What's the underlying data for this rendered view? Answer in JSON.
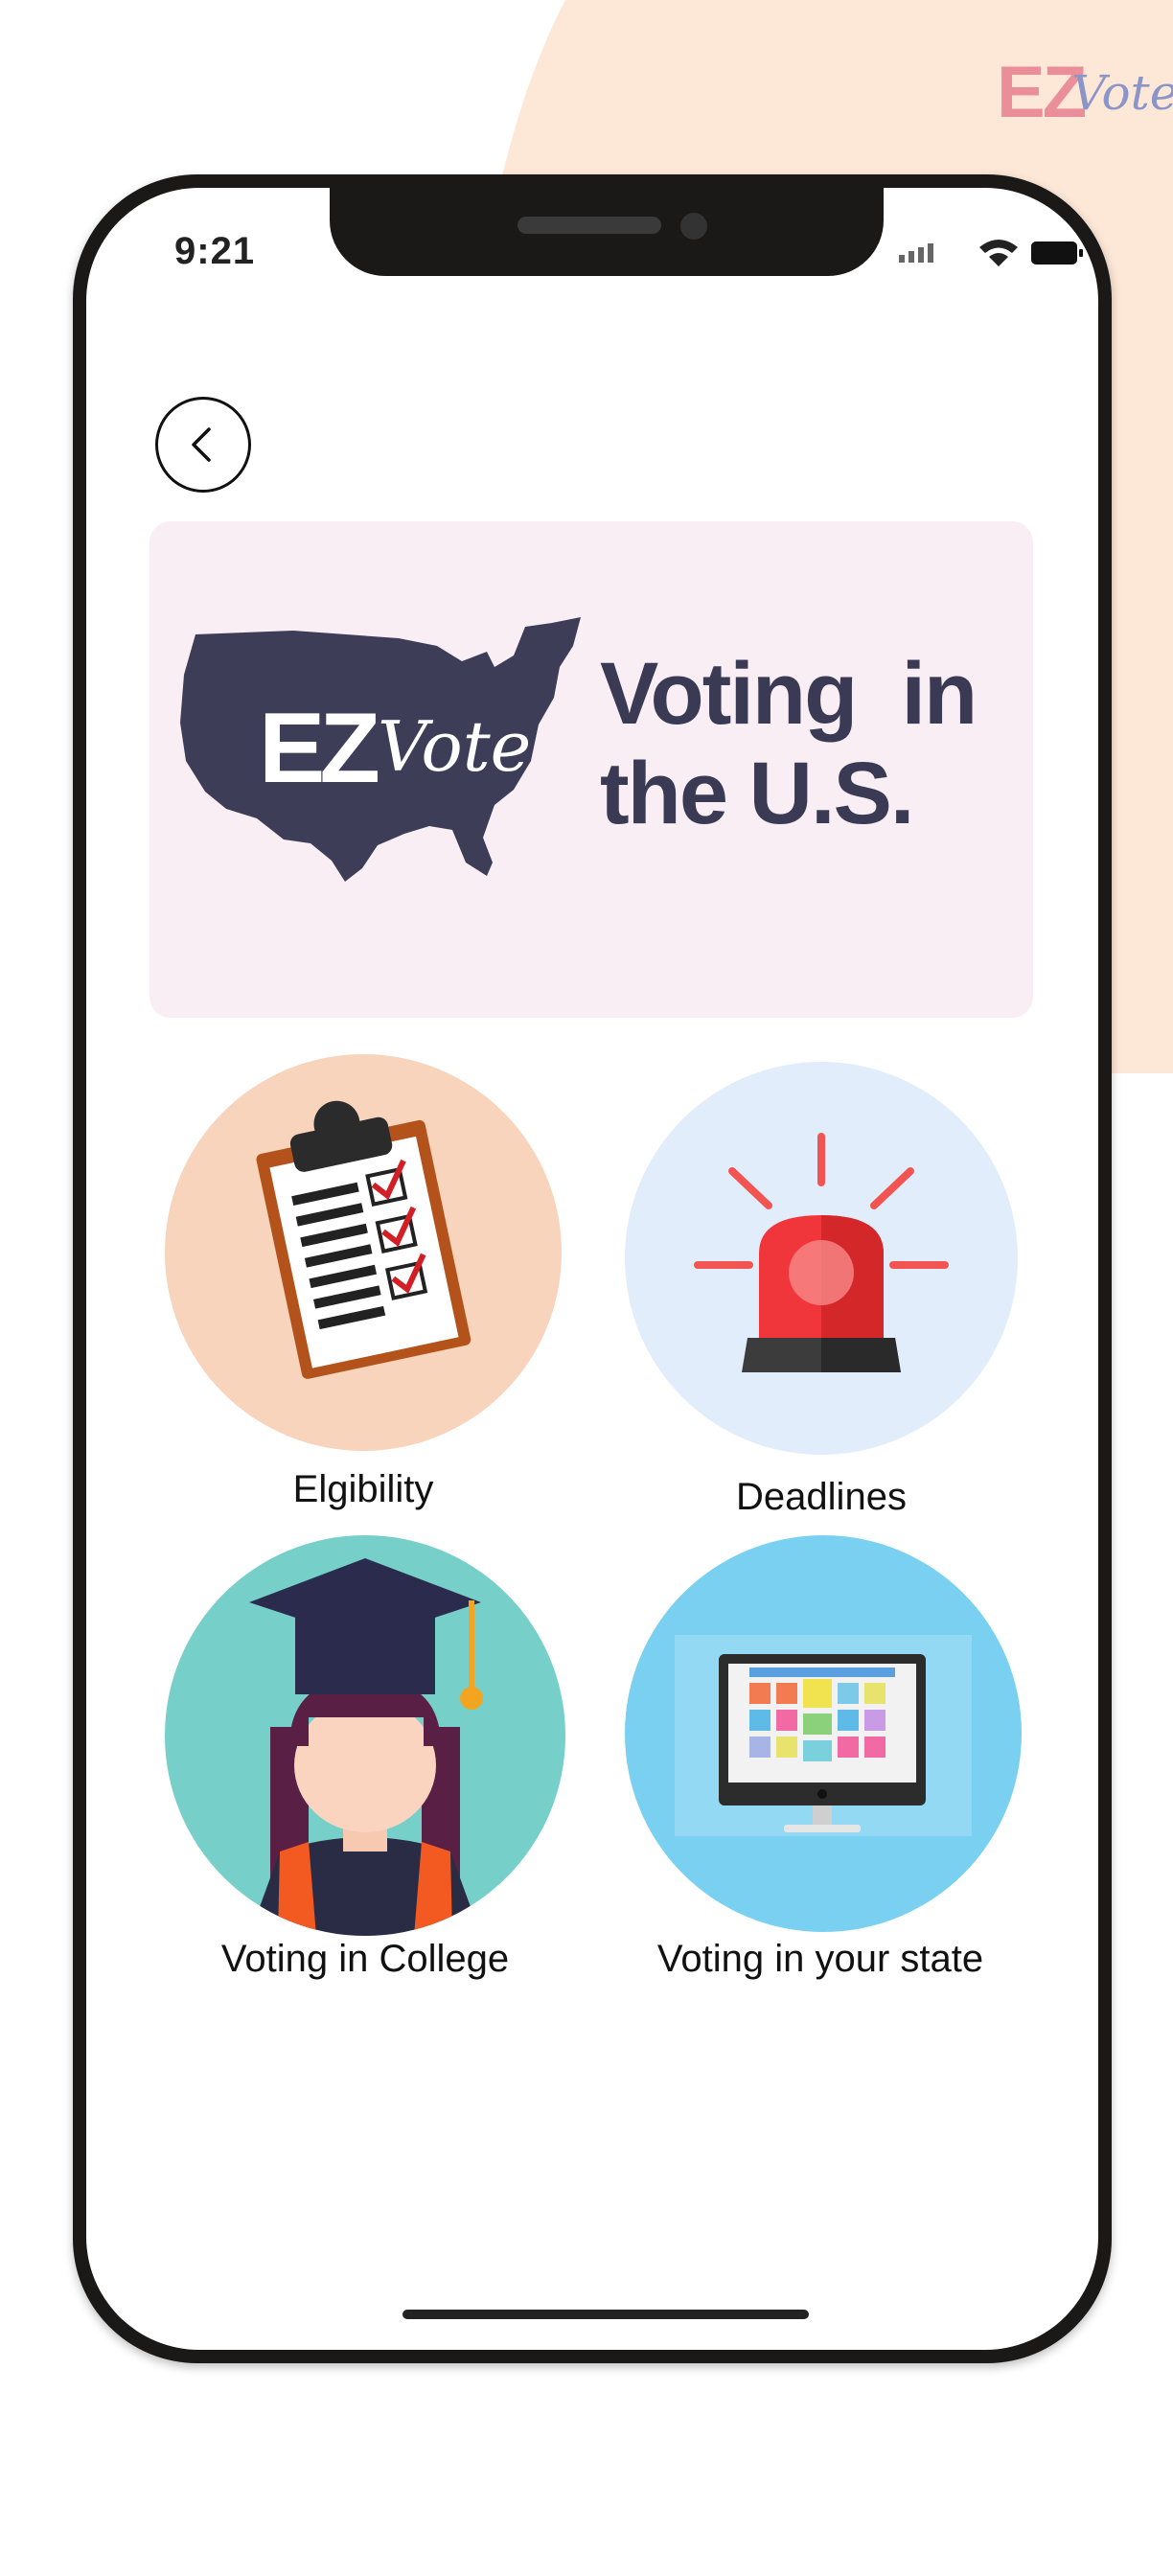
{
  "brand": {
    "logo_ez": "EZ",
    "logo_vote": "Vote"
  },
  "status_bar": {
    "time": "9:21"
  },
  "header": {
    "back_label": "Back"
  },
  "banner": {
    "logo_ez": "EZ",
    "logo_vote": "Vote",
    "title_line1": "Voting  in",
    "title_line2": "the U.S."
  },
  "categories": [
    {
      "label": "Elgibility",
      "icon": "clipboard-checklist-icon",
      "bg": "#f7d4bb"
    },
    {
      "label": "Deadlines",
      "icon": "siren-icon",
      "bg": "#e2edfb"
    },
    {
      "label": "Voting in College",
      "icon": "graduate-icon",
      "bg": "#76cfc9"
    },
    {
      "label": "Voting in your state",
      "icon": "computer-monitor-icon",
      "bg": "#79d0f1"
    }
  ],
  "colors": {
    "peach_background": "#fde7d7",
    "banner_background": "#f8eef4",
    "brand_navy": "#3b3a55",
    "logo_pink": "#ea8f99",
    "logo_blue": "#8c95c7"
  }
}
